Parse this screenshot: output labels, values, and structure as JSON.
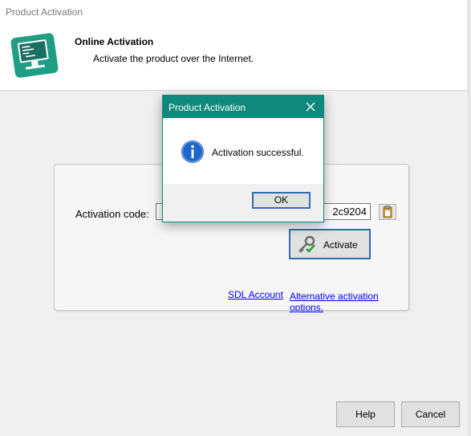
{
  "window": {
    "title": "Product Activation"
  },
  "header": {
    "title": "Online Activation",
    "description": "Activate the product over the Internet.",
    "icon": "monitor-code-icon"
  },
  "activation": {
    "code_label": "Activation code:",
    "code_value": "2c9204",
    "activate_label": "Activate",
    "sdl_account_link": "SDL Account",
    "alternative_link": "Alternative activation options."
  },
  "footer": {
    "help_label": "Help",
    "cancel_label": "Cancel"
  },
  "dialog": {
    "title": "Product Activation",
    "message": "Activation successful.",
    "ok_label": "OK",
    "icon": "info-icon"
  },
  "colors": {
    "accent": "#0f8a7a",
    "focus": "#2f6fb1",
    "link": "#0000ee"
  }
}
